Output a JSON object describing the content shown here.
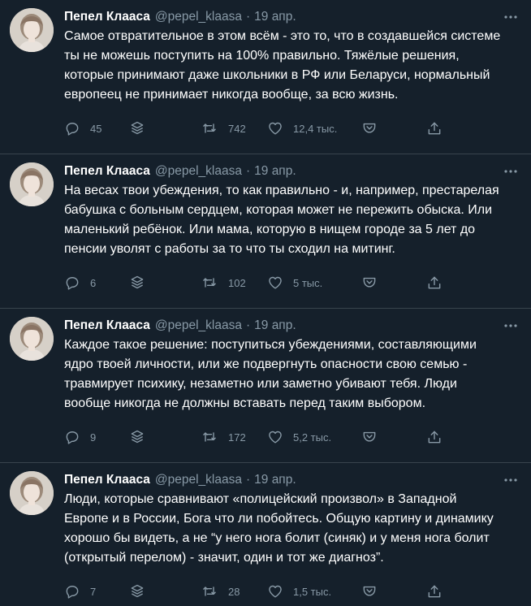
{
  "tweets": [
    {
      "author_name": "Пепел Клааса",
      "handle": "@pepel_klaasa",
      "separator": "·",
      "date": "19 апр.",
      "text": "Самое отвратительное в этом всём - это то, что в создавшейся системе\nты не можешь поступить на 100% правильно. Тяжёлые решения,\nкоторые принимают даже школьники в РФ или Беларуси, нормальный\nевропеец не принимает никогда вообще, за всю жизнь.",
      "replies": "45",
      "retweets": "742",
      "likes": "12,4 тыс."
    },
    {
      "author_name": "Пепел Клааса",
      "handle": "@pepel_klaasa",
      "separator": "·",
      "date": "19 апр.",
      "text": "На весах твои убеждения, то как правильно - и, например, престарелая\nбабушка с больным сердцем, которая может не пережить обыска. Или\nмаленький ребёнок. Или мама, которую в нищем городе за 5 лет до\nпенсии уволят с работы за то что ты сходил на митинг.",
      "replies": "6",
      "retweets": "102",
      "likes": "5 тыс."
    },
    {
      "author_name": "Пепел Клааса",
      "handle": "@pepel_klaasa",
      "separator": "·",
      "date": "19 апр.",
      "text": "Каждое такое решение: поступиться убеждениями, составляющими\nядро твоей личности, или же подвергнуть опасности свою семью -\nтравмирует психику, незаметно или заметно убивают тебя. Люди\nвообще никогда не должны вставать перед таким выбором.",
      "replies": "9",
      "retweets": "172",
      "likes": "5,2 тыс."
    },
    {
      "author_name": "Пепел Клааса",
      "handle": "@pepel_klaasa",
      "separator": "·",
      "date": "19 апр.",
      "text": "Люди, которые сравнивают «полицейский произвол» в Западной\nЕвропе и в России, Бога что ли побойтесь. Общую картину и динамику\nхорошо бы видеть, а не “у него нога болит (синяк) и у меня нога болит\n(открытый перелом) - значит, один и тот же диагноз”.",
      "replies": "7",
      "retweets": "28",
      "likes": "1,5 тыс."
    }
  ],
  "icons": {
    "reply": "reply-icon",
    "analytics": "analytics-icon",
    "retweet": "retweet-icon",
    "like": "like-icon",
    "bookmark": "bookmark-icon",
    "share": "share-icon",
    "more": "more-icon"
  },
  "colors": {
    "background": "#15202b",
    "text": "#ffffff",
    "secondary": "#8899a6",
    "divider": "#38444d"
  }
}
